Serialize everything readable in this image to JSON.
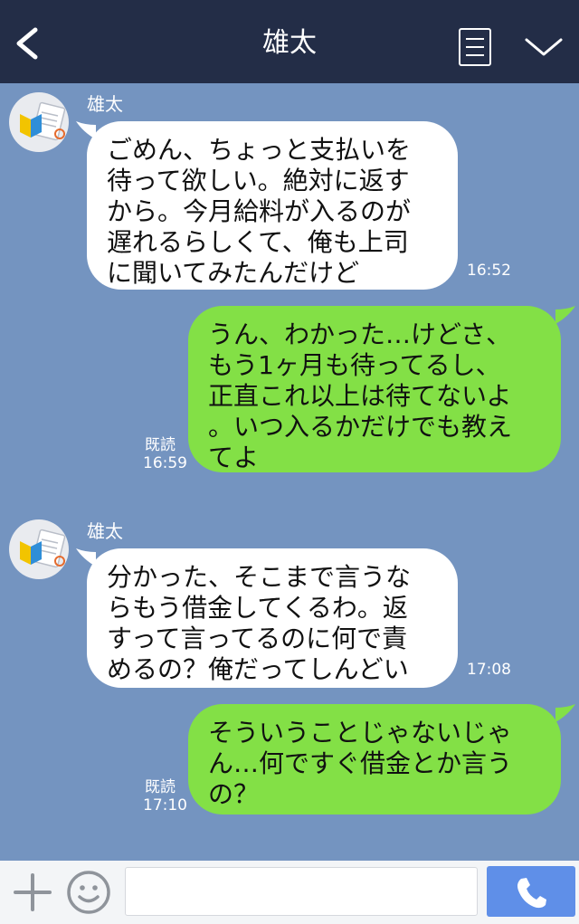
{
  "header": {
    "title": "雄太"
  },
  "messages": [
    {
      "direction": "incoming",
      "sender": "雄太",
      "text": "ごめん、ちょっと支払いを\n待って欲しい。絶対に返す\nから。今月給料が入るのが\n遅れるらしくて、俺も上司\nに聞いてみたんだけど",
      "time": "16:52"
    },
    {
      "direction": "outgoing",
      "read": "既読",
      "text": "うん、わかった…けどさ、\nもう1ヶ月も待ってるし、\n正直これ以上は待てないよ\n。いつ入るかだけでも教え\nてよ",
      "time": "16:59"
    },
    {
      "direction": "incoming",
      "sender": "雄太",
      "text": "分かった、そこまで言うな\nらもう借金してくるわ。返\nすって言ってるのに何で責\nめるの？俺だってしんどい",
      "time": "17:08"
    },
    {
      "direction": "outgoing",
      "read": "既読",
      "text": "そういうことじゃないじゃ\nん…何ですぐ借金とか言う\nの？",
      "time": "17:10"
    }
  ],
  "footer": {
    "input_value": ""
  },
  "icons": {
    "back": "chevron-left-icon",
    "menu": "menu-icon",
    "expand": "chevron-down-icon",
    "plus": "plus-icon",
    "emoji": "smiley-icon",
    "call": "phone-icon",
    "avatar": "beginner-mark-avatar"
  },
  "colors": {
    "header_bg": "#232d47",
    "chat_bg": "#7494c0",
    "incoming_bubble": "#ffffff",
    "outgoing_bubble": "#83e046",
    "call_button": "#5f8fe8",
    "footer_bg": "#f3f5f7"
  }
}
